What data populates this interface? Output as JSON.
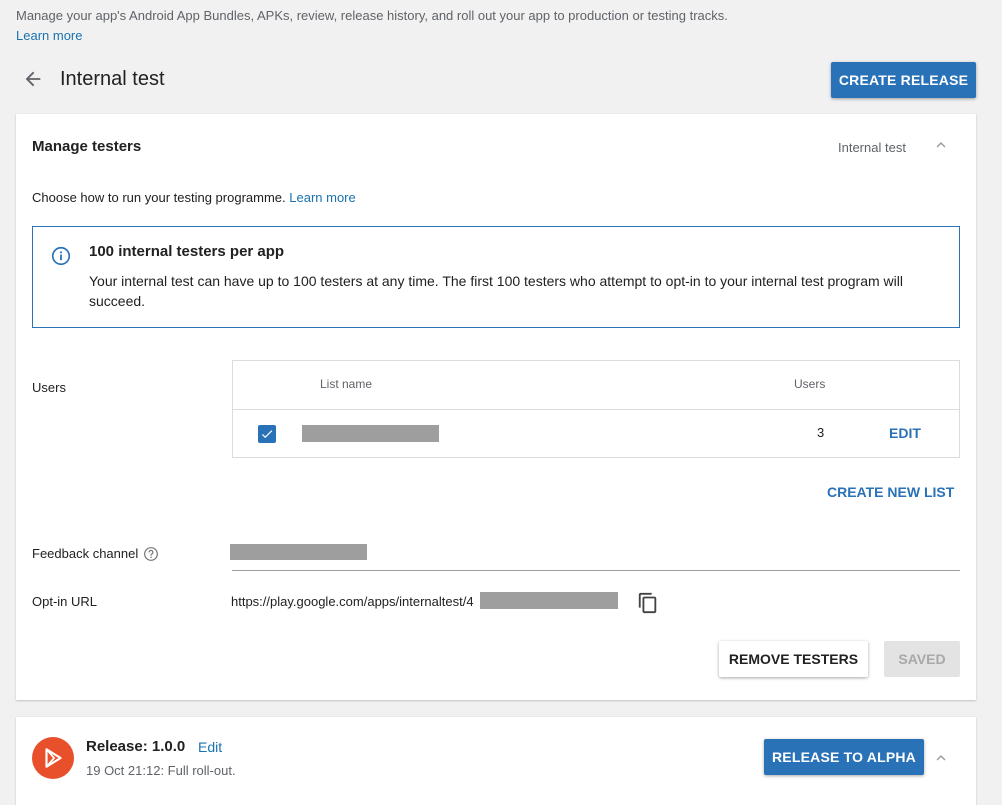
{
  "intro": {
    "description": "Manage your app's Android App Bundles, APKs, review, release history, and roll out your app to production or testing tracks.",
    "learn_more": "Learn more"
  },
  "header": {
    "title": "Internal test",
    "create_release": "CREATE RELEASE"
  },
  "manage_testers": {
    "title": "Manage testers",
    "track_label": "Internal test",
    "choose_text": "Choose how to run your testing programme. ",
    "choose_link": "Learn more",
    "info": {
      "title": "100 internal testers per app",
      "body": "Your internal test can have up to 100 testers at any time. The first 100 testers who attempt to opt-in to your internal test program will succeed."
    },
    "users": {
      "label": "Users",
      "columns": [
        "List name",
        "Users"
      ],
      "rows": [
        {
          "checked": true,
          "name": "",
          "count": "3",
          "action": "EDIT"
        }
      ],
      "create_new_list": "CREATE NEW LIST"
    },
    "feedback": {
      "label": "Feedback channel"
    },
    "optin": {
      "label": "Opt-in URL",
      "url_prefix": "https://play.google.com/apps/internaltest/4"
    },
    "buttons": {
      "remove": "REMOVE TESTERS",
      "saved": "SAVED"
    }
  },
  "release": {
    "title": "Release: 1.0.0",
    "edit": "Edit",
    "subtitle": "19 Oct 21:12: Full roll-out.",
    "button": "RELEASE TO ALPHA"
  },
  "colors": {
    "accent": "#2a72b8",
    "link": "#1a73b0",
    "logo": "#e8502c",
    "background": "#f1f1f1"
  },
  "icons": [
    "back-arrow-icon",
    "chevron-up-icon",
    "info-icon",
    "checkbox-checked-icon",
    "help-icon",
    "copy-icon",
    "play-logo-icon"
  ]
}
